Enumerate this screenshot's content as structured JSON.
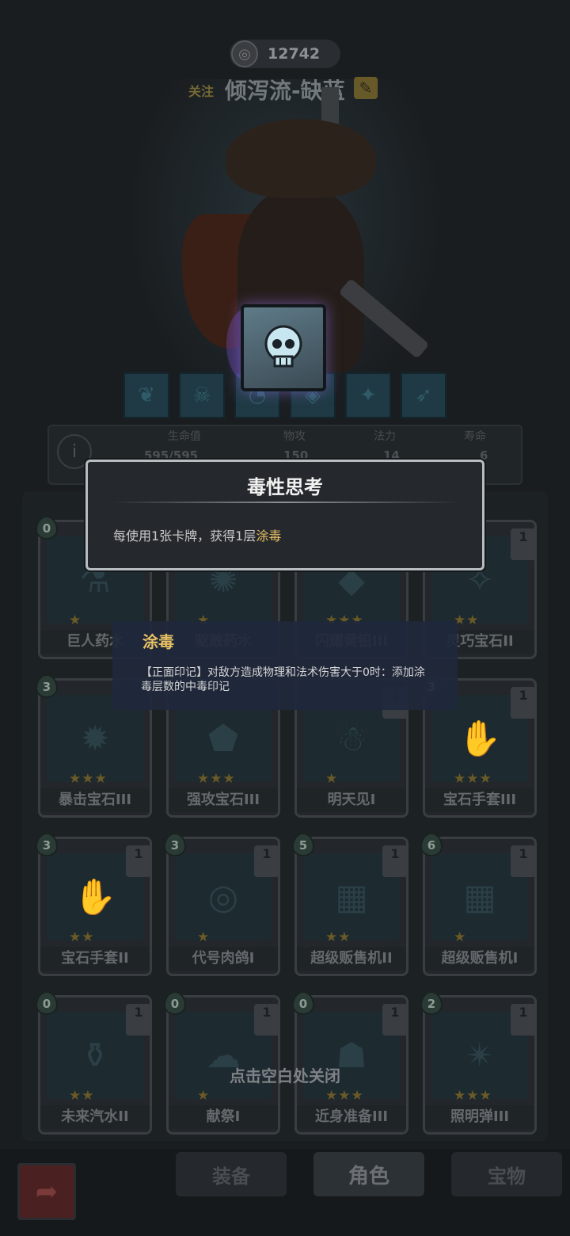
{
  "header": {
    "score": "12742",
    "follow_label": "关注",
    "player_name": "倾泻流-缺蓝"
  },
  "stats": {
    "hp_label": "生命值",
    "hp_value": "595/595",
    "atk_label": "物攻",
    "atk_value": "150",
    "mp_label": "法力",
    "mp_value": "14",
    "life_label": "寿命",
    "life_value": "6"
  },
  "popup": {
    "title": "毒性思考",
    "desc_prefix": "每使用1张卡牌，获得1层",
    "desc_highlight": "涂毒"
  },
  "tooltip": {
    "title": "涂毒",
    "desc": "【正面印记】对敌方造成物理和法术伤害大于0时：添加涂毒层数的中毒印记"
  },
  "cards": [
    {
      "name": "巨人药水",
      "cost": "0",
      "stack": "",
      "stars": "★"
    },
    {
      "name": "驱散药水",
      "cost": "",
      "stack": "",
      "stars": "★"
    },
    {
      "name": "闪耀黄铅III",
      "cost": "",
      "stack": "",
      "stars": "★★★"
    },
    {
      "name": "灵巧宝石II",
      "cost": "",
      "stack": "1",
      "stars": "★★"
    },
    {
      "name": "暴击宝石III",
      "cost": "3",
      "stack": "",
      "stars": "★★★"
    },
    {
      "name": "强攻宝石III",
      "cost": "",
      "stack": "",
      "stars": "★★★"
    },
    {
      "name": "明天见I",
      "cost": "",
      "stack": "1",
      "stars": "★"
    },
    {
      "name": "宝石手套III",
      "cost": "3",
      "stack": "1",
      "stars": "★★★"
    },
    {
      "name": "宝石手套II",
      "cost": "3",
      "stack": "1",
      "stars": "★★"
    },
    {
      "name": "代号肉鸽I",
      "cost": "3",
      "stack": "1",
      "stars": "★"
    },
    {
      "name": "超级贩售机II",
      "cost": "5",
      "stack": "1",
      "stars": "★★"
    },
    {
      "name": "超级贩售机I",
      "cost": "6",
      "stack": "1",
      "stars": "★"
    },
    {
      "name": "未来汽水II",
      "cost": "0",
      "stack": "1",
      "stars": "★★"
    },
    {
      "name": "献祭I",
      "cost": "0",
      "stack": "1",
      "stars": "★"
    },
    {
      "name": "近身准备III",
      "cost": "0",
      "stack": "1",
      "stars": "★★★"
    },
    {
      "name": "照明弹III",
      "cost": "2",
      "stack": "1",
      "stars": "★★★"
    }
  ],
  "close_hint": "点击空白处关闭",
  "nav": {
    "tab_equipment": "装备",
    "tab_role": "角色",
    "tab_treasure": "宝物"
  },
  "icons": {
    "score": "target-icon",
    "edit": "pencil-icon",
    "featured": "skull-icon",
    "info": "info-icon",
    "back": "back-arrow-icon"
  }
}
